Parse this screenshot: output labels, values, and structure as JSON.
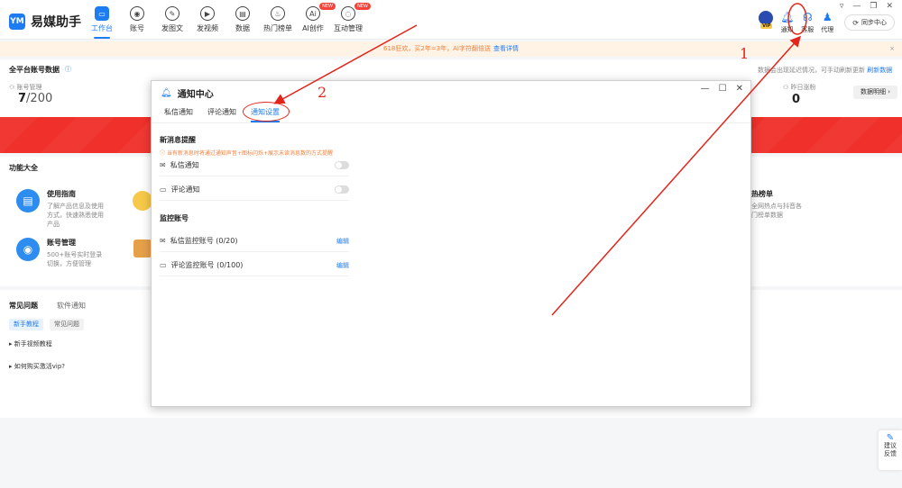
{
  "app": {
    "logo_badge": "YM",
    "name": "易媒助手"
  },
  "nav": [
    {
      "label": "工作台",
      "icon": "workbench-icon",
      "glyph": "▭"
    },
    {
      "label": "账号",
      "icon": "user-icon",
      "glyph": "◉"
    },
    {
      "label": "发图文",
      "icon": "leaf-icon",
      "glyph": "✎"
    },
    {
      "label": "发视频",
      "icon": "play-icon",
      "glyph": "▶"
    },
    {
      "label": "数据",
      "icon": "chart-icon",
      "glyph": "▤"
    },
    {
      "label": "热门榜单",
      "icon": "fire-icon",
      "glyph": "♨"
    },
    {
      "label": "AI创作",
      "icon": "ai-icon",
      "glyph": "Ai",
      "badge": "NEW"
    },
    {
      "label": "互动管理",
      "icon": "chat-icon",
      "glyph": "◌",
      "badge": "NEW"
    }
  ],
  "window_controls": {
    "menu": "▿",
    "minimize": "—",
    "restore": "❐",
    "close": "✕"
  },
  "right_tools": {
    "vip": "VIP",
    "notify": "通知",
    "service": "客服",
    "agent": "代理",
    "sync": "同步中心"
  },
  "notice": {
    "text": "618狂欢，买2年=3年，AI字符翻倍送",
    "link": "查看详情"
  },
  "dashboard": {
    "section_title": "全平台账号数据",
    "account_label": "账号管理",
    "account_count": "7",
    "account_total": "/200",
    "yesterday_label": "昨日涨粉",
    "yesterday_value": "0",
    "data_detail_btn": "数据明细 ›",
    "right_note": "数据会出现延迟情况，可手动刷新更新",
    "refresh_link": "刷新数据",
    "features_title": "功能大全",
    "features": [
      {
        "title": "使用指南",
        "desc": "了解产品信息及使用方式，快速熟悉使用产品"
      },
      {
        "title": "账号管理",
        "desc": "500+账号实时登录切换，方便管理"
      }
    ],
    "hot_title": "热榜单",
    "hot_desc": "全网热点与抖音各门榜单数据",
    "faq_tabs": [
      "常见问题",
      "软件通知"
    ],
    "faq_chips": [
      "新手教程",
      "常见问题"
    ],
    "faq_items": [
      "新手视频教程",
      "如何购买激活vip?"
    ]
  },
  "feedback": {
    "line1": "建议",
    "line2": "反馈"
  },
  "modal": {
    "title": "通知中心",
    "minimize": "—",
    "maximize": "☐",
    "close": "✕",
    "tabs": [
      "私信通知",
      "评论通知",
      "通知设置"
    ],
    "active_tab": 2,
    "new_msg_title": "新消息提醒",
    "new_msg_hint": "当有新消息时将通过通知声音+图标闪烁+展示未读消息数的方式提醒",
    "new_msg_rows": [
      "私信通知",
      "评论通知"
    ],
    "monitor_title": "监控账号",
    "monitor_rows": [
      {
        "label": "私信监控账号 (0/20)",
        "action": "编辑"
      },
      {
        "label": "评论监控账号 (0/100)",
        "action": "编辑"
      }
    ]
  },
  "annotations": {
    "one": "1",
    "two": "2"
  },
  "colors": {
    "accent": "#1e7cf2",
    "banner": "#f0302a",
    "annotation": "#e3241b",
    "notice_text": "#f0803c"
  }
}
